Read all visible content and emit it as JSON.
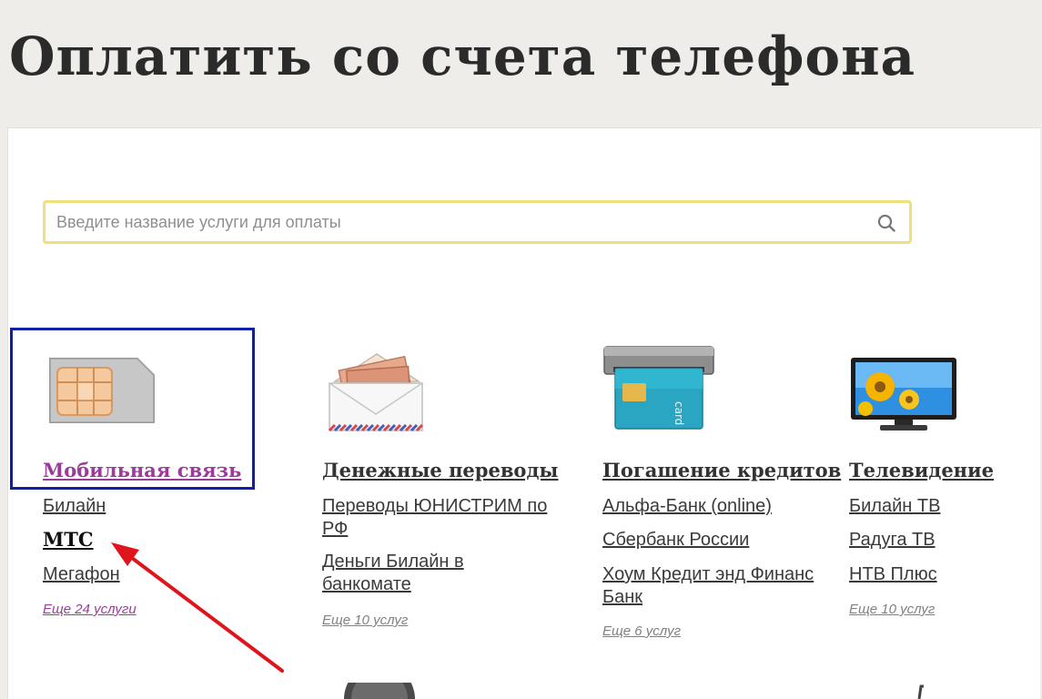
{
  "page": {
    "title": "Оплатить со счета телефона"
  },
  "search": {
    "placeholder": "Введите название услуги для оплаты"
  },
  "categories": [
    {
      "title": "Мобильная связь",
      "icon": "sim-card-icon",
      "links": [
        "Билайн",
        "МТС",
        "Мегафон"
      ],
      "more": "Еще 24 услуги"
    },
    {
      "title": "Денежные переводы",
      "icon": "money-envelope-icon",
      "links": [
        "Переводы ЮНИСТРИМ по РФ",
        "Деньги Билайн в банкомате"
      ],
      "more": "Еще 10 услуг"
    },
    {
      "title": "Погашение кредитов",
      "icon": "atm-card-icon",
      "links": [
        "Альфа-Банк (online)",
        "Сбербанк России",
        "Хоум Кредит энд Финанс Банк"
      ],
      "more": "Еще 6 услуг"
    },
    {
      "title": "Телевидение",
      "icon": "tv-icon",
      "links": [
        "Билайн ТВ",
        "Радуга ТВ",
        "НТВ Плюс"
      ],
      "more": "Еще 10 услуг"
    }
  ],
  "colors": {
    "accent_purple": "#9b3c9b",
    "highlight_blue": "#0d1fa6",
    "search_border": "#f0df7c",
    "arrow_red": "#e0141b"
  }
}
